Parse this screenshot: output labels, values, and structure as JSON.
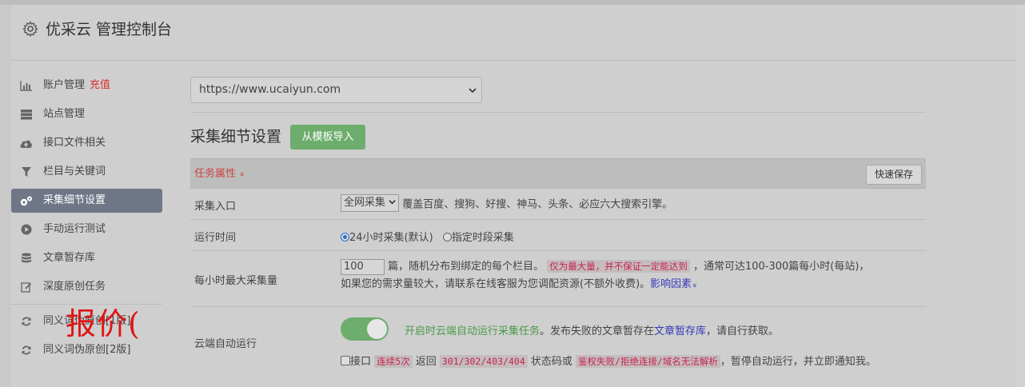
{
  "header": {
    "title": "优采云 管理控制台",
    "icon": "gear-icon"
  },
  "sidebar": {
    "items": [
      {
        "label": "账户管理",
        "extra": "充值",
        "icon": "bar-chart-icon"
      },
      {
        "label": "站点管理",
        "icon": "server-icon"
      },
      {
        "label": "接口文件相关",
        "icon": "cloud-upload-icon"
      },
      {
        "label": "栏目与关键词",
        "icon": "filter-icon"
      },
      {
        "label": "采集细节设置",
        "icon": "gears-icon",
        "active": true
      },
      {
        "label": "手动运行测试",
        "icon": "play-icon"
      },
      {
        "label": "文章暂存库",
        "icon": "database-icon"
      },
      {
        "label": "深度原创任务",
        "icon": "edit-icon"
      },
      {
        "label": "同义词伪原创[1版]",
        "icon": "refresh-icon"
      },
      {
        "label": "同义词伪原创[2版]",
        "icon": "refresh-icon"
      }
    ],
    "overlay_text": "报价("
  },
  "main": {
    "site_select": {
      "value": "https://www.ucaiyun.com"
    },
    "section_title": "采集细节设置",
    "import_button": "从模板导入",
    "table": {
      "header_label": "任务属性",
      "header_chevron": "»",
      "quick_save": "快速保存",
      "rows": {
        "entry": {
          "key": "采集入口",
          "select_value": "全网采集",
          "desc": "覆盖百度、搜狗、好搜、神马、头条、必应六大搜索引擎。"
        },
        "time": {
          "key": "运行时间",
          "opt1": "24小时采集(默认)",
          "opt2": "指定时段采集"
        },
        "max": {
          "key": "每小时最大采集量",
          "input_value": "100",
          "text1": "篇，随机分布到绑定的每个栏目。",
          "code": "仅为最大量，并不保证一定能达到",
          "text2": "，通常可达100-300篇每小时(每站)，",
          "text3": "如果您的需求量较大，请联系在线客服为您调配资源(不额外收费)。",
          "link": "影响因素",
          "link_chevron": "»"
        },
        "cloud": {
          "key": "云端自动运行",
          "toggle_on": true,
          "green_text": "开启时云端自动运行采集任务",
          "text1": "。发布失败的文章暂存在",
          "link": "文章暂存库",
          "text2": "，请自行获取。",
          "cb_label": "接口",
          "code1": "连续5次",
          "text3": "返回",
          "code2": "301/302/403/404",
          "text4": "状态码或",
          "code3": "鉴权失败/拒绝连接/域名无法解析",
          "text5": "，暂停自动运行，并立即通知我。"
        }
      }
    }
  },
  "colors": {
    "accent_green": "#6dad6d",
    "active_item": "#6f7787",
    "warn_red": "#d9302a"
  }
}
